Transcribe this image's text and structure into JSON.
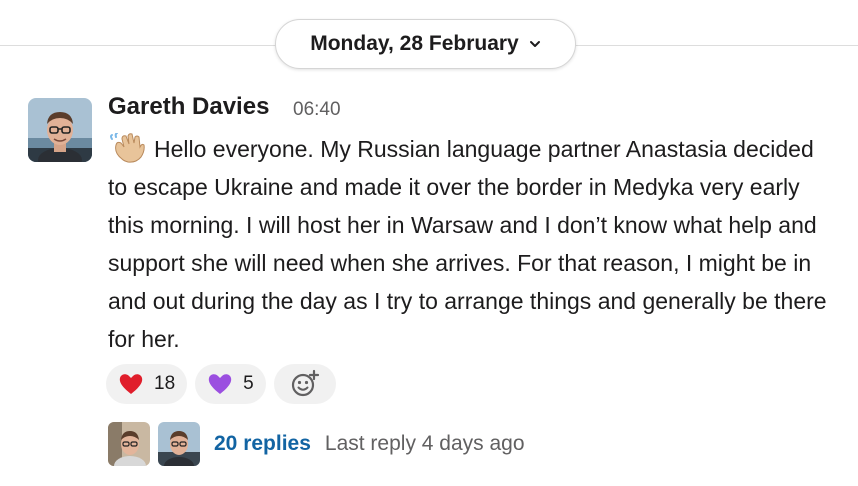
{
  "date_divider": {
    "label": "Monday, 28 February"
  },
  "message": {
    "author": "Gareth Davies",
    "time": "06:40",
    "emoji": "waving-hand",
    "text": "Hello everyone. My Russian language partner Anastasia decided to escape Ukraine and made it over the border in Medyka very early this morning. I will host her in Warsaw and I don’t know what help and support she will need when she arrives. For that reason, I might be in and out during the day as I try to arrange things and generally be there for her."
  },
  "reactions": [
    {
      "emoji": "red-heart",
      "count": "18",
      "color": "#e01e2b"
    },
    {
      "emoji": "purple-heart",
      "count": "5",
      "color": "#8e44d6"
    }
  ],
  "thread": {
    "replies": "20 replies",
    "last_reply": "Last reply 4 days ago"
  },
  "colors": {
    "link": "#1264a3",
    "muted": "#616061",
    "pill_bg": "#f1f1f1"
  }
}
